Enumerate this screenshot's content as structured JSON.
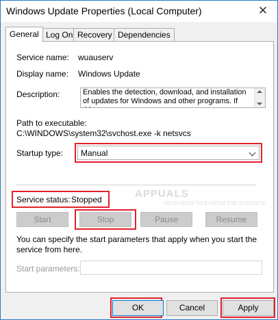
{
  "window": {
    "title": "Windows Update Properties (Local Computer)",
    "close_glyph": "✕"
  },
  "tabs": [
    {
      "label": "General",
      "active": true
    },
    {
      "label": "Log On"
    },
    {
      "label": "Recovery"
    },
    {
      "label": "Dependencies"
    }
  ],
  "general": {
    "service_name_label": "Service name:",
    "service_name_value": "wuauserv",
    "display_name_label": "Display name:",
    "display_name_value": "Windows Update",
    "description_label": "Description:",
    "description_value": "Enables the detection, download, and installation of updates for Windows and other programs. If this",
    "path_label": "Path to executable:",
    "path_value": "C:\\WINDOWS\\system32\\svchost.exe -k netsvcs",
    "startup_type_label": "Startup type:",
    "startup_type_value": "Manual",
    "service_status_label": "Service status:",
    "service_status_value": "Stopped",
    "buttons": {
      "start": "Start",
      "stop": "Stop",
      "pause": "Pause",
      "resume": "Resume"
    },
    "info_text": "You can specify the start parameters that apply when you start the service from here.",
    "start_params_label": "Start parameters:",
    "start_params_value": ""
  },
  "footer": {
    "ok": "OK",
    "cancel": "Cancel",
    "apply": "Apply"
  },
  "watermark": {
    "brand": "APPUALS",
    "tagline": "TECH HOW-TO'S FROM THE EXPERTS!"
  },
  "colors": {
    "highlight": "#e0202a",
    "accent": "#0078d7"
  }
}
